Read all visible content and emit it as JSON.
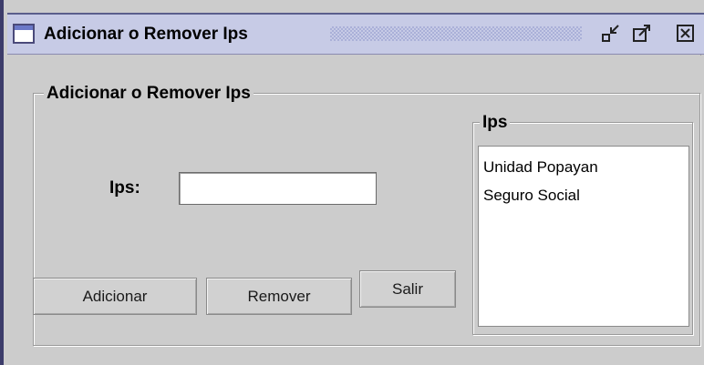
{
  "window": {
    "title": "Adicionar o Remover Ips",
    "controls": {
      "minimize_icon": "minimize-icon",
      "maximize_icon": "maximize-icon",
      "close_icon": "close-icon"
    }
  },
  "form": {
    "group_title": "Adicionar o Remover Ips",
    "ips_label": "Ips:",
    "ips_input": {
      "value": "",
      "placeholder": ""
    }
  },
  "ips_list": {
    "group_title": "Ips",
    "items": [
      "Unidad Popayan",
      "Seguro Social"
    ]
  },
  "buttons": {
    "add": "Adicionar",
    "remove": "Remover",
    "exit": "Salir"
  },
  "colors": {
    "window_bg": "#cccccc",
    "titlebar_bg": "#c7cbe6",
    "frame": "#3c3c6a"
  }
}
